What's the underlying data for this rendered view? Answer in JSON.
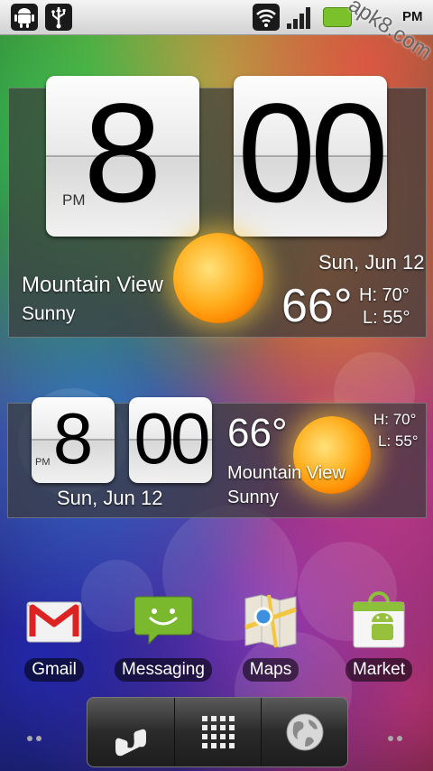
{
  "status_bar": {
    "left_icons": [
      "android-debug-icon",
      "usb-icon"
    ],
    "right_icons": [
      "wifi-icon",
      "signal-icon",
      "battery-icon"
    ],
    "time_suffix": "PM",
    "watermark": "apk8.com"
  },
  "widget_large": {
    "hour": "8",
    "minutes": "00",
    "ampm": "PM",
    "city": "Mountain View",
    "condition": "Sunny",
    "date": "Sun, Jun 12",
    "temperature": "66°",
    "high": "H: 70°",
    "low": "L: 55°"
  },
  "widget_small": {
    "hour": "8",
    "minutes": "00",
    "ampm": "PM",
    "date": "Sun, Jun 12",
    "temperature": "66°",
    "city": "Mountain View",
    "condition": "Sunny",
    "high": "H: 70°",
    "low": "L: 55°"
  },
  "apps": [
    {
      "label": "Gmail",
      "icon": "gmail-icon"
    },
    {
      "label": "Messaging",
      "icon": "messaging-icon"
    },
    {
      "label": "Maps",
      "icon": "maps-icon"
    },
    {
      "label": "Market",
      "icon": "market-icon"
    }
  ],
  "dock": {
    "buttons": [
      "phone-icon",
      "app-drawer-icon",
      "browser-icon"
    ]
  },
  "colors": {
    "status_bar": "#e6e6e6",
    "widget_panel": "#3c3c3c",
    "battery": "#7bc12b",
    "sun": "#ffb020"
  }
}
